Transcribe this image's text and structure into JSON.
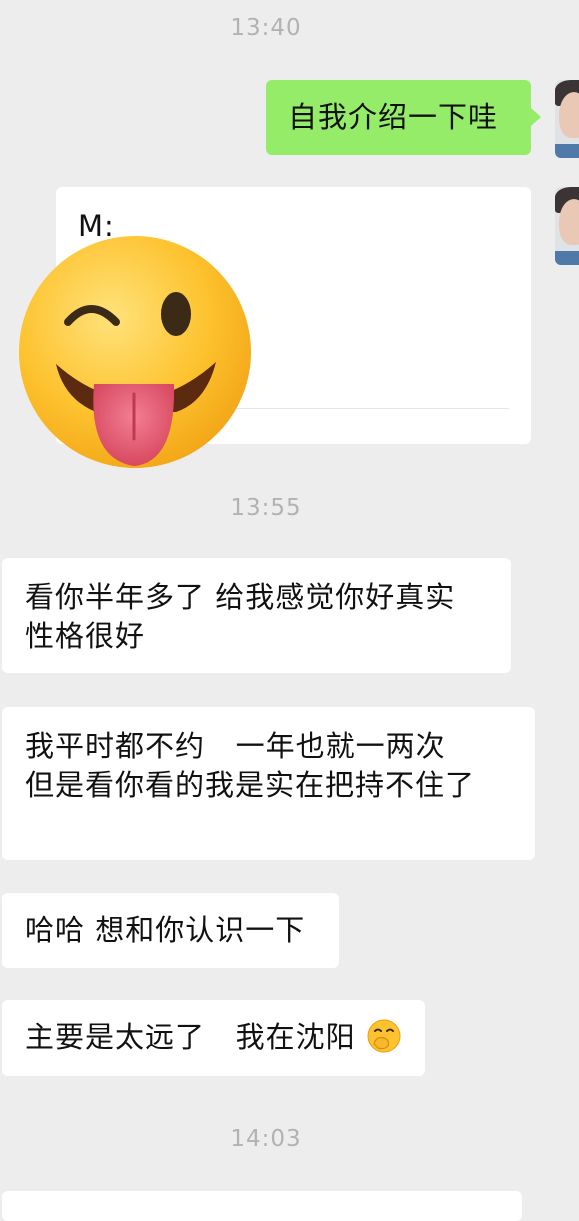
{
  "messages": {
    "time1": "13:40",
    "msg_out_1": "自我介绍一下哇",
    "card_label": "M:",
    "time2": "13:55",
    "msg_in_1": "看你半年多了 给我感觉你好真实\n性格很好",
    "msg_in_2": "我平时都不约   一年也就一两次\n但是看你看的我是实在把持不住了",
    "msg_in_3": "哈哈 想和你认识一下",
    "msg_in_4": "主要是太远了   我在沈阳",
    "time3": "14:03"
  },
  "icons": {
    "sticker": "winking-face-with-tongue-icon",
    "inline_emoji": "hand-over-mouth-emoji-icon",
    "avatar": "user-avatar"
  },
  "colors": {
    "background": "#ededed",
    "incoming_bubble": "#ffffff",
    "outgoing_bubble": "#95ec69",
    "timestamp": "#b2b2b2"
  }
}
